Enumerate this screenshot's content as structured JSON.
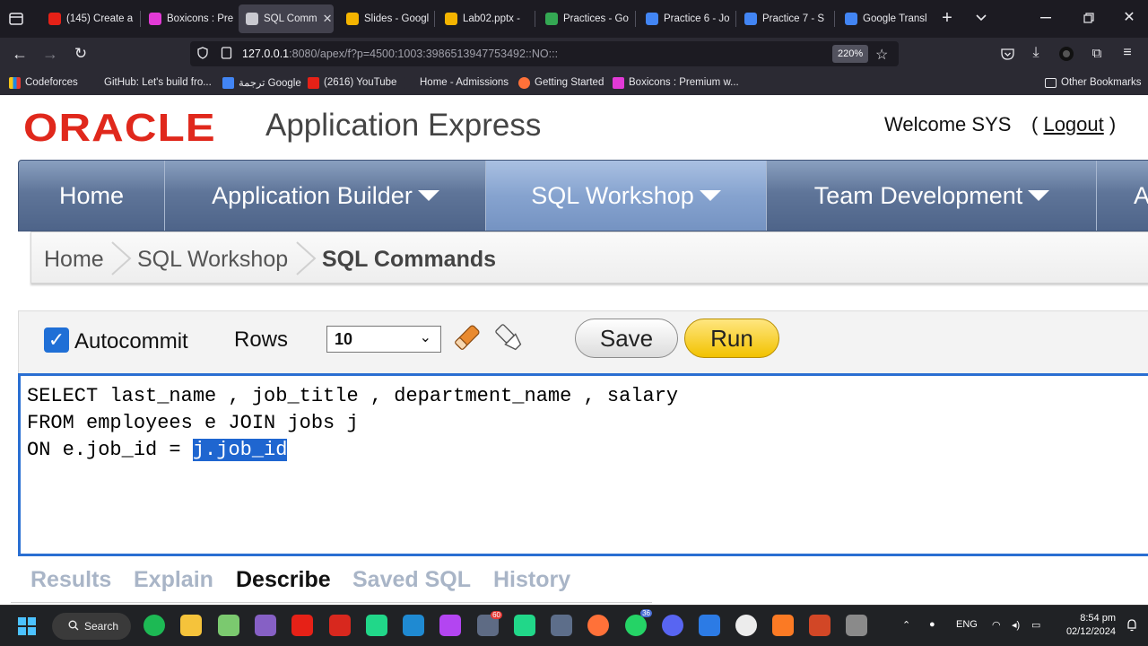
{
  "browser": {
    "tabs": [
      {
        "label": "(145) Create a",
        "color": "#e62117",
        "active": false
      },
      {
        "label": "Boxicons : Pre",
        "color": "#e23ad6",
        "active": false
      },
      {
        "label": "SQL Comm",
        "color": "#c9c9d0",
        "active": true
      },
      {
        "label": "Slides - Googl",
        "color": "#34a853",
        "active": false
      },
      {
        "label": "Lab02.pptx - ",
        "color": "#f4b400",
        "active": false
      },
      {
        "label": "Practices - Go",
        "color": "#34a853",
        "active": false
      },
      {
        "label": "Practice 6 - Jo",
        "color": "#4285f4",
        "active": false
      },
      {
        "label": "Practice 7 - S",
        "color": "#4285f4",
        "active": false
      },
      {
        "label": "Google Transl",
        "color": "#4285f4",
        "active": false
      }
    ],
    "new_tab": "+",
    "url_host": "127.0.0.1",
    "url_path": ":8080/apex/f?p=4500:1003:3986513947753492::NO:::",
    "zoom": "220%",
    "bookmarks": [
      {
        "label": "Codeforces",
        "color": "#f5c518"
      },
      {
        "label": "GitHub: Let's build fro...",
        "color": "#2b2a33"
      },
      {
        "label": "ترجمة Google",
        "color": "#4285f4"
      },
      {
        "label": "(2616) YouTube",
        "color": "#e62117"
      },
      {
        "label": "Home - Admissions",
        "color": "#2b2a33"
      },
      {
        "label": "Getting Started",
        "color": "#ff7139"
      },
      {
        "label": "Boxicons : Premium w...",
        "color": "#e23ad6"
      }
    ],
    "other_bookmarks": "Other Bookmarks"
  },
  "apex": {
    "logo_text": "ORACLE",
    "logo_sub": "Application Express",
    "welcome": "Welcome SYS",
    "logout_open": "(",
    "logout": "Logout",
    "logout_close": ")",
    "nav": [
      {
        "label": "Home",
        "caret": false,
        "active": false
      },
      {
        "label": "Application Builder",
        "caret": true,
        "active": false
      },
      {
        "label": "SQL Workshop",
        "caret": true,
        "active": true
      },
      {
        "label": "Team Development",
        "caret": true,
        "active": false
      },
      {
        "label": "A",
        "caret": false,
        "active": false
      }
    ],
    "breadcrumb": [
      "Home",
      "SQL Workshop",
      "SQL Commands"
    ],
    "toolbar": {
      "autocommit_label": "Autocommit",
      "autocommit_checked": true,
      "rows_label": "Rows",
      "rows_value": "10",
      "save_label": "Save",
      "run_label": "Run"
    },
    "editor": {
      "line1": "SELECT last_name , job_title , department_name , salary",
      "line2": "FROM employees e JOIN jobs j",
      "line3_prefix": "ON e.job_id = ",
      "line3_selected": "j.job_id"
    },
    "result_tabs": [
      {
        "label": "Results",
        "active": false
      },
      {
        "label": "Explain",
        "active": false
      },
      {
        "label": "Describe",
        "active": true
      },
      {
        "label": "Saved SQL",
        "active": false
      },
      {
        "label": "History",
        "active": false
      }
    ]
  },
  "taskbar": {
    "search_label": "Search",
    "lang": "ENG",
    "time": "8:54 pm",
    "date": "02/12/2024",
    "badge_1": "60",
    "badge_2": "36"
  }
}
